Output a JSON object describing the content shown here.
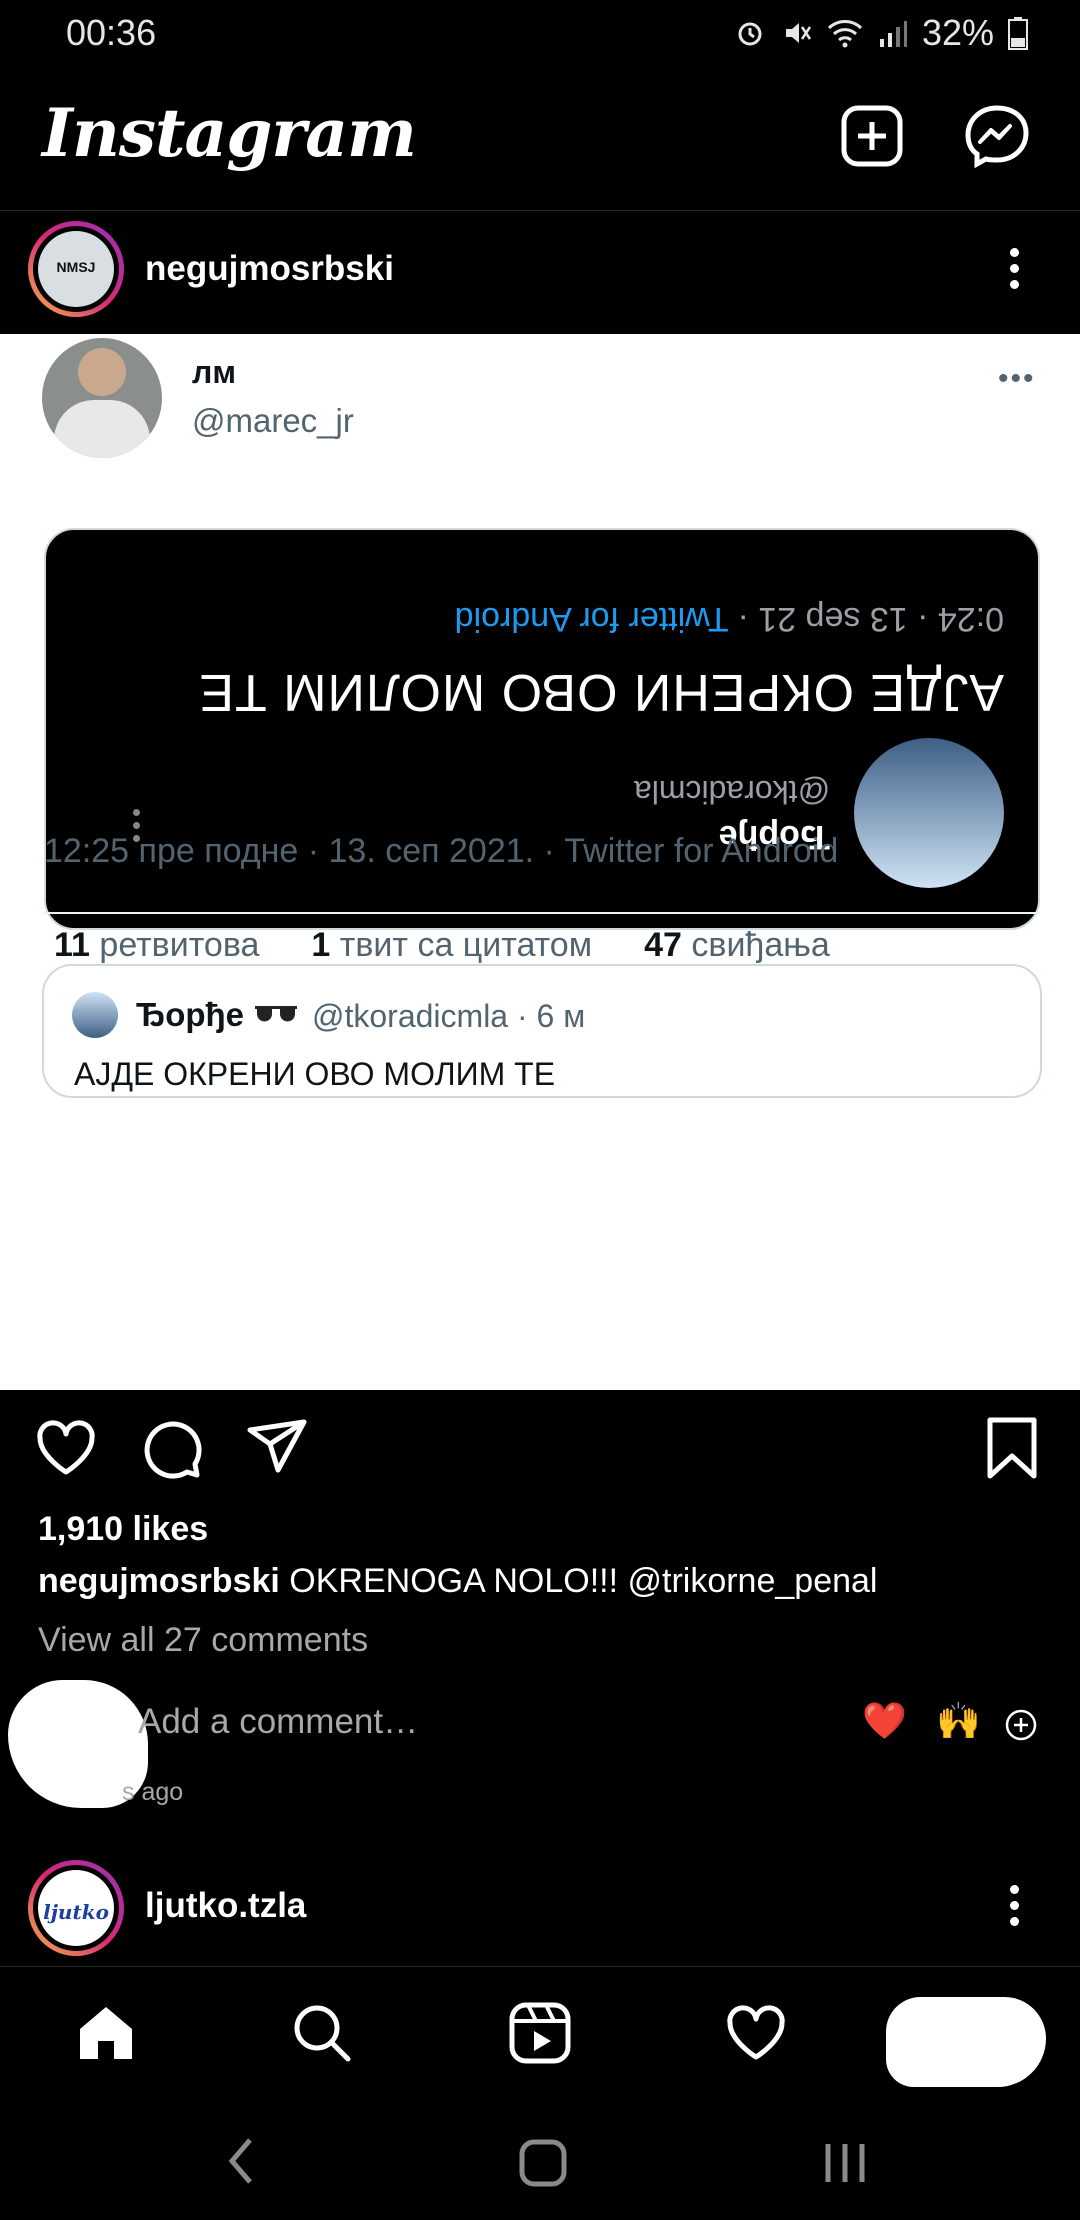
{
  "status_bar": {
    "time": "00:36",
    "battery": "32%"
  },
  "app": {
    "title": "Instagram"
  },
  "post": {
    "username": "negujmosrbski",
    "avatar_text": "NMSJ",
    "tweet": {
      "name": "лм",
      "handle": "@marec_jr",
      "media": {
        "line1": "0:24 · 13 sep 21 · ",
        "line1_link": "Twitter for Android",
        "headline": "АЈДЕ ОКРЕНИ ОВО МОЛИМ ТЕ",
        "handle": "@tkoradicmla",
        "name": "Ђорђе"
      },
      "quote": {
        "name": "Ђорђе",
        "handle_time": "@tkoradicmla · 6 м",
        "text": "АЈДЕ ОКРЕНИ ОВО МОЛИМ ТЕ"
      },
      "meta": "12:25 пре подне · 13. сеп 2021. · Twitter for Android",
      "stats": [
        {
          "count": "11",
          "label": "ретвитова"
        },
        {
          "count": "1",
          "label": "твит са цитатом"
        },
        {
          "count": "47",
          "label": "свиђања"
        }
      ]
    },
    "likes": "1,910 likes",
    "caption_user": "negujmosrbski",
    "caption_text": "OKRENOGA NOLO!!! @trikorne_penal",
    "view_comments": "View all 27 comments",
    "add_comment_placeholder": "Add a comment…",
    "quick_emojis": [
      "❤️",
      "🙌"
    ],
    "time_ago": "s ago"
  },
  "next_post": {
    "username": "ljutko.tzla",
    "avatar_text": "ljutko"
  },
  "colors": {
    "background": "#000000",
    "card": "#ffffff",
    "muted": "#a8a8a8",
    "twitter_blue": "#1d9bf0",
    "heart": "#ed4956"
  }
}
